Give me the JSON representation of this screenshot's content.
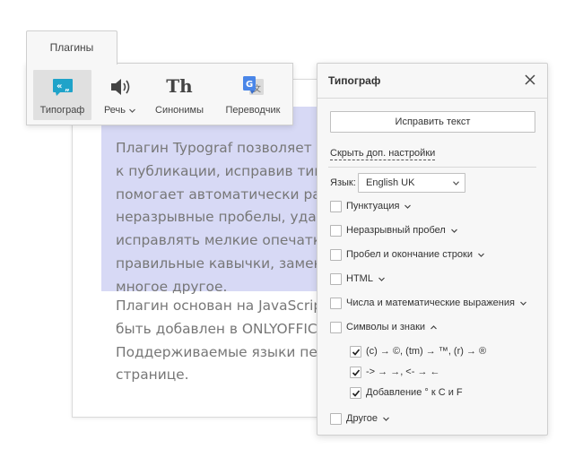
{
  "document": {
    "paragraph1": [
      "Плагин Typograf позволяет п",
      "к публикации, исправив типо",
      "помогает автоматически раз",
      "неразрывные пробелы, удал",
      "исправлять мелкие опечатки",
      "правильные кавычки, замен",
      "многое другое."
    ],
    "paragraph2": [
      "Плагин основан на JavaScript",
      "быть добавлен в ONLYOFFICE",
      "Поддерживаемые языки пер",
      "странице."
    ]
  },
  "plugins_tab": {
    "label": "Плагины"
  },
  "toolbar": {
    "items": [
      {
        "label": "Типограф",
        "icon": "typograf-quotes-icon",
        "active": true
      },
      {
        "label": "Речь",
        "icon": "speaker-icon",
        "dropdown": true
      },
      {
        "label": "Синонимы",
        "icon": "th-icon",
        "glyph": "Th"
      },
      {
        "label": "Переводчик",
        "icon": "google-translate-icon"
      }
    ]
  },
  "panel": {
    "title": "Типограф",
    "fix_button": "Исправить текст",
    "hide_settings_link": "Скрыть доп. настройки",
    "language_label": "Язык:",
    "language_value": "English UK",
    "options": [
      {
        "label": "Пунктуация",
        "checked": false,
        "expanded": false
      },
      {
        "label": "Неразрывный пробел",
        "checked": false,
        "expanded": false
      },
      {
        "label": "Пробел и окончание строки",
        "checked": false,
        "expanded": false
      },
      {
        "label": "HTML",
        "checked": false,
        "expanded": false
      },
      {
        "label": "Числа и математические выражения",
        "checked": false,
        "expanded": false
      },
      {
        "label": "Символы и знаки",
        "checked": false,
        "expanded": true
      },
      {
        "label": "Другое",
        "checked": false,
        "expanded": false
      }
    ],
    "suboptions": [
      {
        "label": "(c) → ©, (tm) → ™, (r) → ®",
        "checked": true
      },
      {
        "label": "-> → →, <- → ←",
        "checked": true
      },
      {
        "label": "Добавление ° к C и F",
        "checked": true
      }
    ]
  },
  "colors": {
    "highlight": "#d7d9f5",
    "panel_bg": "#f7f7f7",
    "typograf_icon": "#1fa3c9",
    "doc_text": "#777777"
  }
}
